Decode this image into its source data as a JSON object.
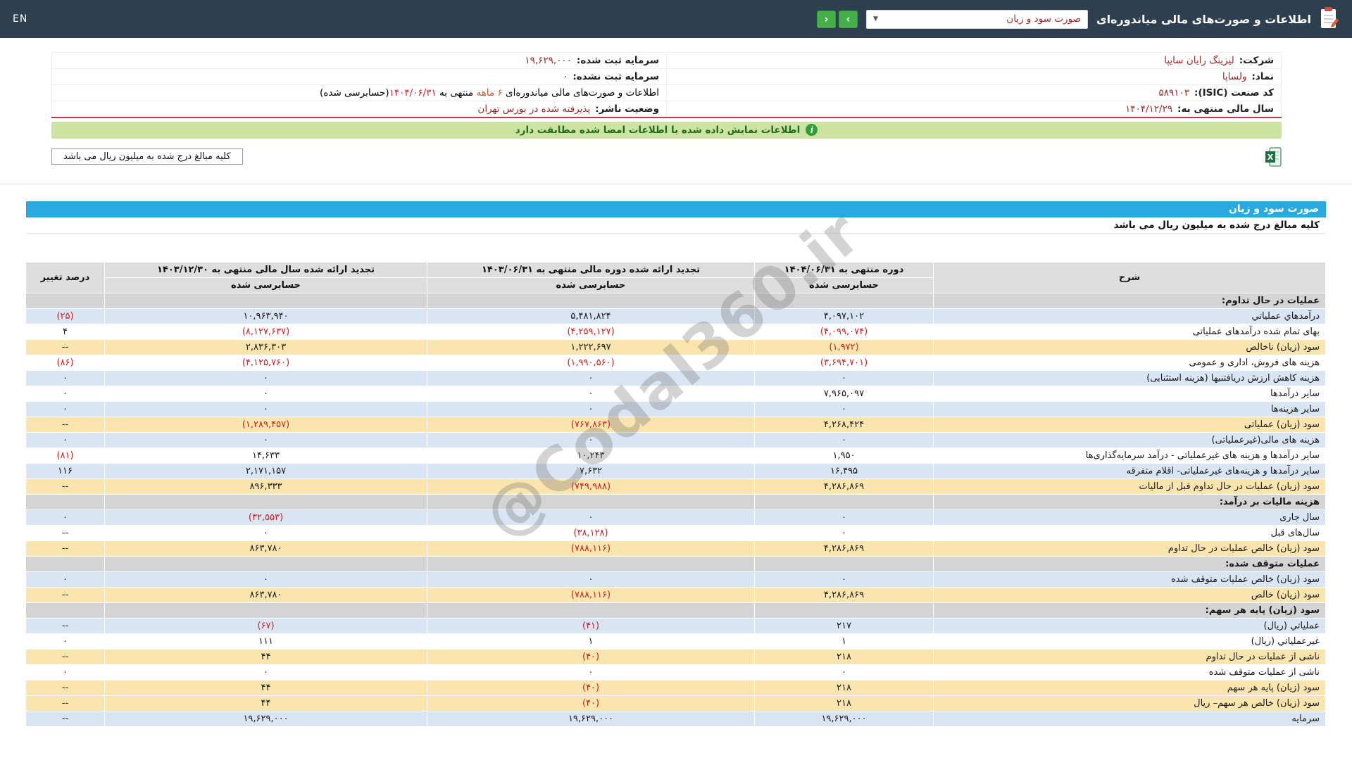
{
  "topbar": {
    "title": "اطلاعات و صورت‌های مالی میاندوره‌ای",
    "dropdown_value": "صورت سود و زیان",
    "nav_next": "‹",
    "nav_prev": "›",
    "en_label": "EN"
  },
  "company_info": {
    "rows": [
      {
        "cells": [
          {
            "label": "شرکت:",
            "value": "لیزینگ رایان سایپا"
          },
          {
            "label": "سرمایه ثبت شده:",
            "value": "۱۹,۶۲۹,۰۰۰"
          }
        ]
      },
      {
        "cells": [
          {
            "label": "نماد:",
            "value": "ولساپا"
          },
          {
            "label": "سرمایه ثبت نشده:",
            "value": "۰"
          }
        ]
      },
      {
        "cells": [
          {
            "label": "کد صنعت (ISIC):",
            "value": "۵۸۹۱۰۳"
          },
          {
            "parts": [
              {
                "text": "اطلاعات و صورت‌های مالی میاندوره‌ای "
              },
              {
                "text": "۶ ماهه",
                "cls": "orange"
              },
              {
                "text": " منتهی به "
              },
              {
                "text": "۱۴۰۴/۰۶/۳۱",
                "cls": "red"
              },
              {
                "text": "(حسابرسی شده)"
              }
            ]
          }
        ]
      },
      {
        "cells": [
          {
            "label": "سال مالی منتهی به:",
            "value": "۱۴۰۴/۱۲/۲۹"
          },
          {
            "label": "وضعیت ناشر:",
            "value": "پذیرفته شده در بورس تهران"
          }
        ]
      }
    ]
  },
  "banner": {
    "text": "اطلاعات نمایش داده شده با اطلاعات امضا شده مطابقت دارد"
  },
  "unit_note": "کلیه مبالغ درج شده به میلیون ریال می باشد",
  "report": {
    "title": "صورت سود و زیان",
    "unit_note": "کلیه مبالغ درج شده به میلیون ریال می باشد",
    "columns": {
      "desc": "شرح",
      "period_current": "دوره منتهی به ۱۴۰۴/۰۶/۳۱",
      "period_prev": "تجدید ارائه شده دوره مالی منتهی به ۱۴۰۳/۰۶/۳۱",
      "period_year": "تجدید ارائه شده سال مالی منتهی به ۱۴۰۳/۱۲/۳۰",
      "audited": "حسابرسی شده",
      "change": "درصد تغییر"
    },
    "rows": [
      {
        "label": "عملیات در حال تداوم:",
        "type": "section"
      },
      {
        "label": "درآمدهاي عملياتي",
        "type": "alt",
        "values": [
          "۴,۰۹۷,۱۰۲",
          "۵,۴۸۱,۸۲۴",
          "۱۰,۹۶۳,۹۴۰",
          "(۲۵)"
        ]
      },
      {
        "label": "بهای تمام شده درآمدهای عملیاتی",
        "type": "plain",
        "values": [
          "(۴,۰۹۹,۰۷۴)",
          "(۴,۲۵۹,۱۲۷)",
          "(۸,۱۲۷,۶۳۷)",
          "۴"
        ]
      },
      {
        "label": "سود (زیان) ناخالص",
        "type": "total",
        "values": [
          "(۱,۹۷۲)",
          "۱,۲۲۲,۶۹۷",
          "۲,۸۳۶,۳۰۳",
          "--"
        ]
      },
      {
        "label": "هزینه های فروش، اداری و عمومی",
        "type": "plain",
        "values": [
          "(۳,۶۹۴,۷۰۱)",
          "(۱,۹۹۰,۵۶۰)",
          "(۴,۱۲۵,۷۶۰)",
          "(۸۶)"
        ]
      },
      {
        "label": "هزینه کاهش ارزش دریافتنیها (هزینه استثنایی)",
        "type": "alt",
        "values": [
          "۰",
          "۰",
          "۰",
          "۰"
        ]
      },
      {
        "label": "سایر درآمدها",
        "type": "plain",
        "values": [
          "۷,۹۶۵,۰۹۷",
          "۰",
          "۰",
          "۰"
        ]
      },
      {
        "label": "سایر هزینه‌ها",
        "type": "alt",
        "values": [
          "۰",
          "۰",
          "۰",
          "۰"
        ]
      },
      {
        "label": "سود (زیان) عملیاتی",
        "type": "total",
        "values": [
          "۴,۲۶۸,۴۲۴",
          "(۷۶۷,۸۶۳)",
          "(۱,۲۸۹,۴۵۷)",
          "--"
        ]
      },
      {
        "label": "هزینه های مالی(غیرعملیاتی)",
        "type": "alt",
        "values": [
          "۰",
          "۰",
          "۰",
          "۰"
        ]
      },
      {
        "label": "سایر درآمدها و هزینه های غیرعملیاتی - درآمد سرمایه‌گذاری‌ها",
        "type": "plain",
        "values": [
          "۱,۹۵۰",
          "۱۰,۲۴۳",
          "۱۴,۶۳۳",
          "(۸۱)"
        ]
      },
      {
        "label": "سایر درآمدها و هزینه‌های غیرعملیاتی- اقلام متفرقه",
        "type": "alt",
        "values": [
          "۱۶,۴۹۵",
          "۷,۶۳۲",
          "۲,۱۷۱,۱۵۷",
          "۱۱۶"
        ]
      },
      {
        "label": "سود (زیان) عملیات در حال تداوم قبل از مالیات",
        "type": "total",
        "values": [
          "۴,۲۸۶,۸۶۹",
          "(۷۴۹,۹۸۸)",
          "۸۹۶,۳۳۳",
          "--"
        ]
      },
      {
        "label": "هزینه مالیات بر درآمد:",
        "type": "section"
      },
      {
        "label": "سال جاری",
        "type": "alt",
        "values": [
          "۰",
          "۰",
          "(۳۲,۵۵۳)",
          "۰"
        ]
      },
      {
        "label": "سال‌های قبل",
        "type": "plain",
        "values": [
          "۰",
          "(۳۸,۱۲۸)",
          "۰",
          "--"
        ]
      },
      {
        "label": "سود (زیان) خالص عملیات در حال تداوم",
        "type": "total",
        "values": [
          "۴,۲۸۶,۸۶۹",
          "(۷۸۸,۱۱۶)",
          "۸۶۳,۷۸۰",
          "--"
        ]
      },
      {
        "label": "عملیات متوقف شده:",
        "type": "section"
      },
      {
        "label": "سود (زیان) خالص عملیات متوقف شده",
        "type": "alt",
        "values": [
          "۰",
          "۰",
          "۰",
          "۰"
        ]
      },
      {
        "label": "سود (زیان) خالص",
        "type": "total",
        "values": [
          "۴,۲۸۶,۸۶۹",
          "(۷۸۸,۱۱۶)",
          "۸۶۳,۷۸۰",
          "--"
        ]
      },
      {
        "label": "سود (زیان) پایه هر سهم:",
        "type": "section"
      },
      {
        "label": "عملیاتي (ریال)",
        "type": "alt",
        "values": [
          "۲۱۷",
          "(۴۱)",
          "(۶۷)",
          "--"
        ]
      },
      {
        "label": "غیرعملیاتي (ریال)",
        "type": "plain",
        "values": [
          "۱",
          "۱",
          "۱۱۱",
          "۰"
        ]
      },
      {
        "label": "ناشی از عملیات در حال تداوم",
        "type": "total",
        "values": [
          "۲۱۸",
          "(۴۰)",
          "۴۴",
          "--"
        ]
      },
      {
        "label": "ناشی از عملیات متوقف شده",
        "type": "plain",
        "values": [
          "۰",
          "۰",
          "۰",
          "۰"
        ]
      },
      {
        "label": "سود (زیان) پایه هر سهم",
        "type": "total",
        "values": [
          "۲۱۸",
          "(۴۰)",
          "۴۴",
          "--"
        ]
      },
      {
        "label": "سود (زیان) خالص هر سهم– ریال",
        "type": "total",
        "values": [
          "۲۱۸",
          "(۴۰)",
          "۴۴",
          "--"
        ]
      },
      {
        "label": "سرمایه",
        "type": "alt",
        "values": [
          "۱۹,۶۲۹,۰۰۰",
          "۱۹,۶۲۹,۰۰۰",
          "۱۹,۶۲۹,۰۰۰",
          "--"
        ]
      }
    ]
  },
  "watermark": "@Codal360.ir",
  "colors": {
    "topbar_bg": "#2e3f50",
    "accent_blue": "#29a9e0",
    "banner_green": "#cde3a1",
    "row_alt": "#d9e5f3",
    "row_total": "#fbe5ae",
    "row_section": "#d4d4d4",
    "negative_red": "#cf2020",
    "value_maroon": "#9e2a2a",
    "nav_green": "#45b049"
  }
}
